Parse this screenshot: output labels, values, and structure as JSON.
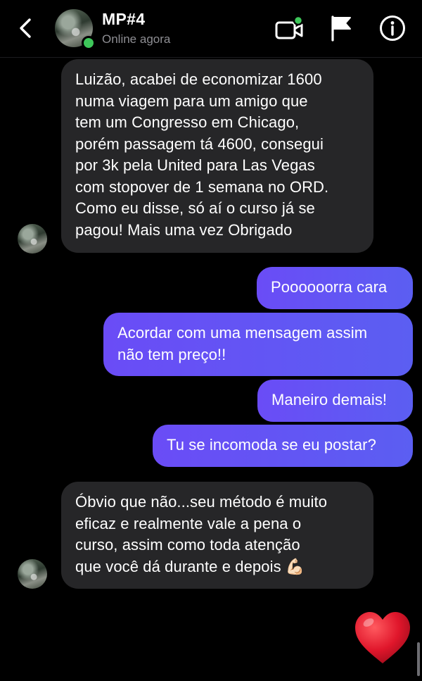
{
  "header": {
    "contact_name": "MP#4",
    "status": "Online agora"
  },
  "messages": [
    {
      "direction": "incoming",
      "text": "Luizão, acabei de economizar 1600\nnuma viagem para um amigo que\ntem um Congresso em Chicago,\nporém passagem tá 4600, consegui\npor 3k pela United para Las Vegas\ncom stopover de 1 semana no ORD.\nComo eu disse, só aí o curso já se\npagou! Mais uma vez Obrigado"
    },
    {
      "direction": "outgoing",
      "text": "Poooooorra cara"
    },
    {
      "direction": "outgoing",
      "text": "Acordar com uma mensagem assim\nnão tem preço!!"
    },
    {
      "direction": "outgoing",
      "text": "Maneiro demais!"
    },
    {
      "direction": "outgoing",
      "text": "Tu se incomoda se eu postar?"
    },
    {
      "direction": "incoming",
      "text": "Óbvio que não...seu método é muito\neficaz e realmente vale a pena o\ncurso, assim como toda atenção\nque você dá durante e depois 💪🏻"
    }
  ],
  "reaction": {
    "emoji": "heart",
    "color": "#e0162b"
  },
  "icons": [
    "back-arrow-icon",
    "video-call-icon",
    "flag-icon",
    "info-icon"
  ],
  "colors": {
    "background": "#000000",
    "incoming_bubble": "#262628",
    "outgoing_bubble": "#5b5ef2",
    "online": "#3ec75a"
  }
}
